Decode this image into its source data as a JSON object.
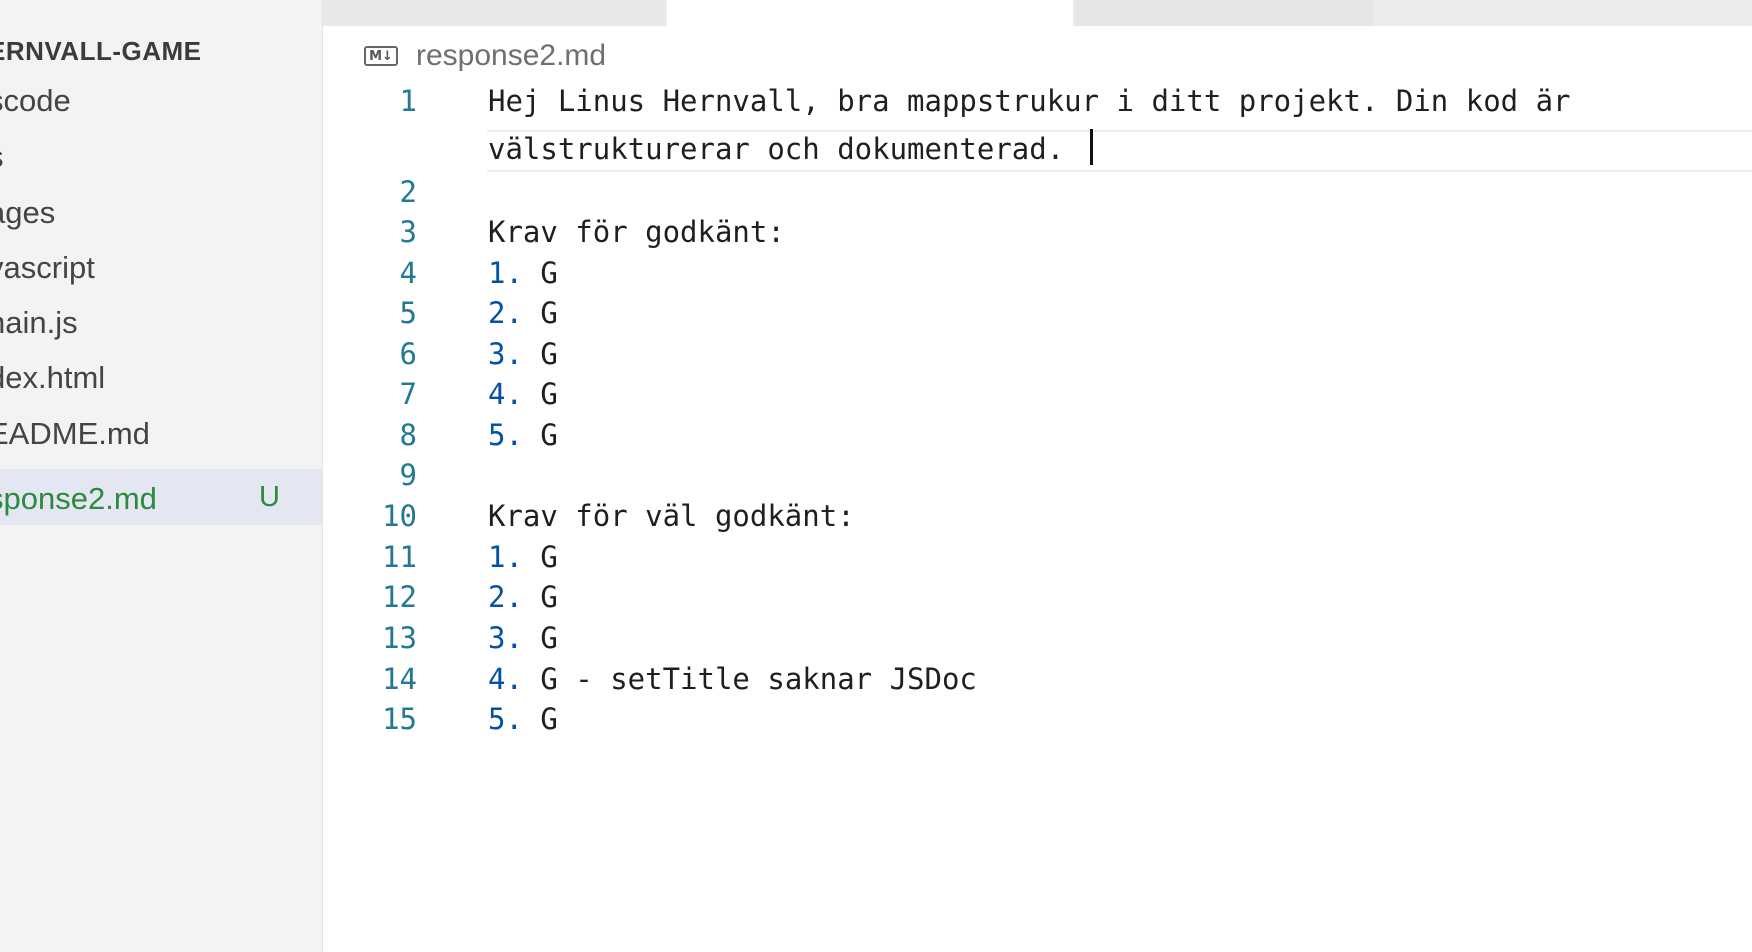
{
  "explorer": {
    "title": "ERNVALL-GAME",
    "items": [
      {
        "label": "scode",
        "status": ""
      },
      {
        "label": "s",
        "status": ""
      },
      {
        "label": "ages",
        "status": ""
      },
      {
        "label": "vascript",
        "status": ""
      },
      {
        "label": "nain.js",
        "status": ""
      },
      {
        "label": "dex.html",
        "status": ""
      },
      {
        "label": "EADME.md",
        "status": ""
      },
      {
        "label": "sponse2.md",
        "status": "U"
      }
    ]
  },
  "breadcrumb": {
    "icon": "markdown-icon",
    "icon_text": "M↓",
    "file": "response2.md"
  },
  "editor": {
    "line1": {
      "number": "1",
      "text": "Hej Linus Hernvall, bra mappstrukur i ditt projekt. Din kod är",
      "wrap": "välstrukturerar och dokumenterad. "
    },
    "line2": {
      "number": "2"
    },
    "line3": {
      "number": "3",
      "text": "Krav för godkänt:"
    },
    "line4": {
      "number": "4",
      "marker": "1.",
      "text": " G"
    },
    "line5": {
      "number": "5",
      "marker": "2.",
      "text": " G"
    },
    "line6": {
      "number": "6",
      "marker": "3.",
      "text": " G"
    },
    "line7": {
      "number": "7",
      "marker": "4.",
      "text": " G"
    },
    "line8": {
      "number": "8",
      "marker": "5.",
      "text": " G"
    },
    "line9": {
      "number": "9"
    },
    "line10": {
      "number": "10",
      "text": "Krav för väl godkänt:"
    },
    "line11": {
      "number": "11",
      "marker": "1.",
      "text": " G"
    },
    "line12": {
      "number": "12",
      "marker": "2.",
      "text": " G"
    },
    "line13": {
      "number": "13",
      "marker": "3.",
      "text": " G"
    },
    "line14": {
      "number": "14",
      "marker": "4.",
      "text": " G - setTitle saknar JSDoc"
    },
    "line15": {
      "number": "15",
      "marker": "5.",
      "text": " G"
    }
  },
  "colors": {
    "sidebar_bg": "#f3f3f3",
    "active_item_bg": "#e4e6f1",
    "untracked_green": "#2b8a3e",
    "line_number": "#237893",
    "list_marker": "#0451a5"
  }
}
